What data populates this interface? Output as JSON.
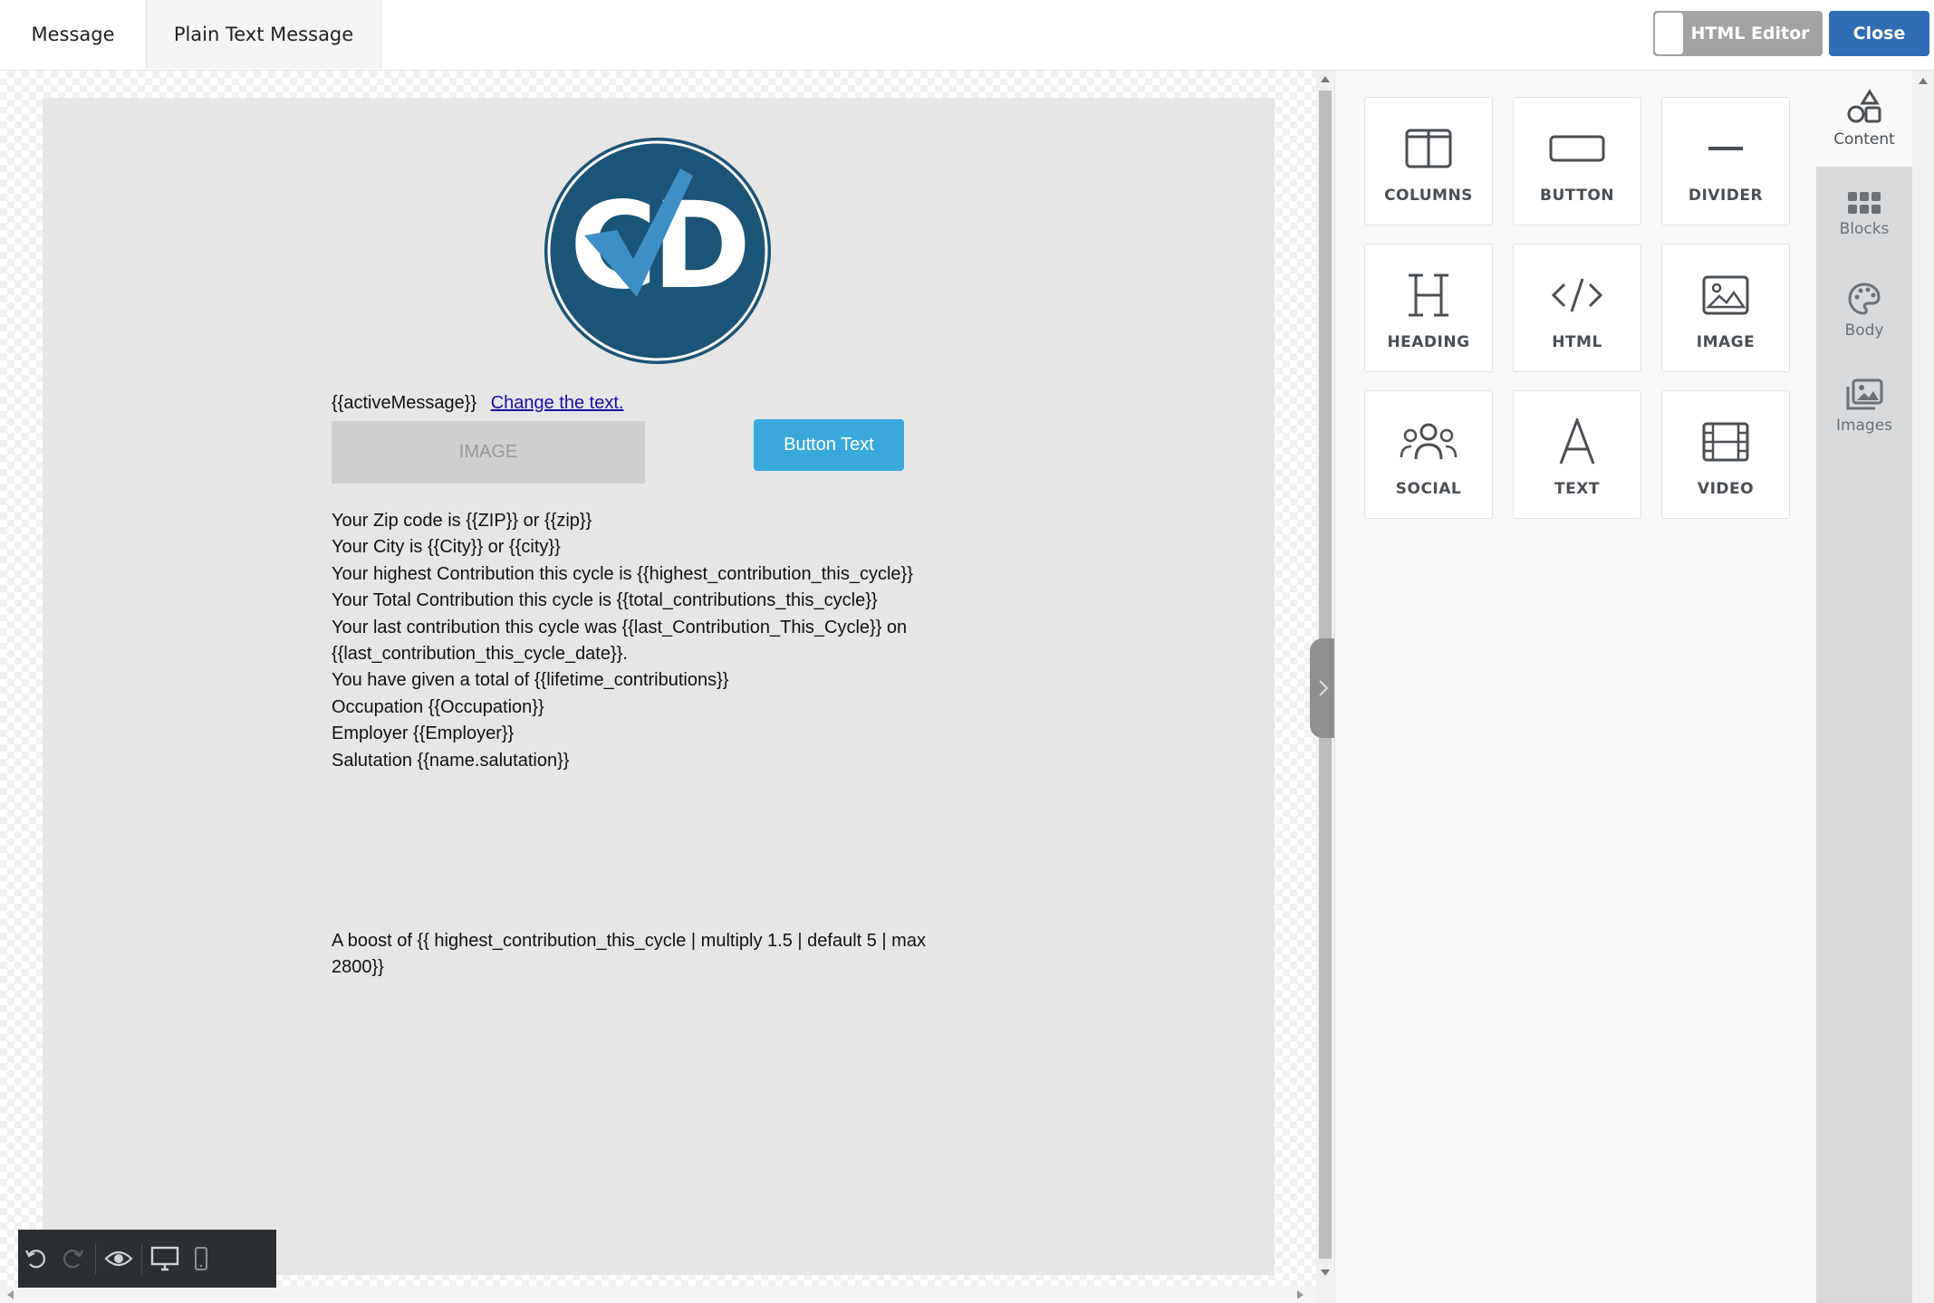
{
  "tabs": {
    "message": "Message",
    "plain_text": "Plain Text Message"
  },
  "header": {
    "html_editor_label": "HTML Editor",
    "close_label": "Close"
  },
  "email": {
    "logo_letters": "CD",
    "active_message": "{{activeMessage}}",
    "change_link": "Change the text.",
    "image_placeholder": "IMAGE",
    "button_text": "Button Text",
    "lines": [
      "Your Zip code is {{ZIP}} or {{zip}}",
      "Your City is {{City}} or {{city}}",
      "Your highest Contribution this cycle is {{highest_contribution_this_cycle}}",
      "Your Total Contribution this cycle is {{total_contributions_this_cycle}}",
      "Your last contribution this cycle was {{last_Contribution_This_Cycle}} on",
      "{{last_contribution_this_cycle_date}}.",
      "You have given a total of {{lifetime_contributions}}",
      "Occupation {{Occupation}}",
      "Employer {{Employer}}",
      "Salutation {{name.salutation}}"
    ],
    "boost_line1": "A boost of {{ highest_contribution_this_cycle | multiply 1.5 | default 5 | max",
    "boost_line2": "2800}}"
  },
  "tools": {
    "columns": "COLUMNS",
    "button": "BUTTON",
    "divider": "DIVIDER",
    "heading": "HEADING",
    "html": "HTML",
    "image": "IMAGE",
    "social": "SOCIAL",
    "text": "TEXT",
    "video": "VIDEO"
  },
  "side_tabs": {
    "content": "Content",
    "blocks": "Blocks",
    "body": "Body",
    "images": "Images"
  },
  "colors": {
    "accent": "#2f6db5",
    "button_blue": "#39a9dc",
    "logo_navy": "#1b5476",
    "check_blue": "#3f8fc7"
  }
}
